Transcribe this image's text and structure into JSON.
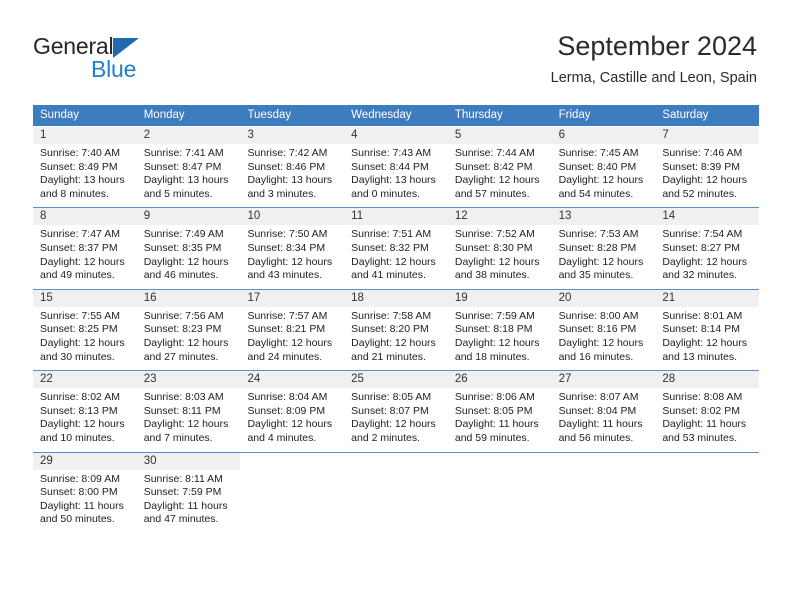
{
  "brand": {
    "name_top": "General",
    "name_bottom": "Blue",
    "triangle_color": "#1f69b0",
    "blue_color": "#1f7fd0"
  },
  "header": {
    "title": "September 2024",
    "subtitle": "Lerma, Castille and Leon, Spain"
  },
  "theme": {
    "header_row_bg": "#3d7cbf",
    "daynum_bg": "#f0f0f0",
    "week_separator": "#5a8fc8",
    "text": "#222222"
  },
  "weekdays": [
    "Sunday",
    "Monday",
    "Tuesday",
    "Wednesday",
    "Thursday",
    "Friday",
    "Saturday"
  ],
  "weeks": [
    [
      {
        "day": "1",
        "sunrise": "Sunrise: 7:40 AM",
        "sunset": "Sunset: 8:49 PM",
        "daylight1": "Daylight: 13 hours",
        "daylight2": "and 8 minutes."
      },
      {
        "day": "2",
        "sunrise": "Sunrise: 7:41 AM",
        "sunset": "Sunset: 8:47 PM",
        "daylight1": "Daylight: 13 hours",
        "daylight2": "and 5 minutes."
      },
      {
        "day": "3",
        "sunrise": "Sunrise: 7:42 AM",
        "sunset": "Sunset: 8:46 PM",
        "daylight1": "Daylight: 13 hours",
        "daylight2": "and 3 minutes."
      },
      {
        "day": "4",
        "sunrise": "Sunrise: 7:43 AM",
        "sunset": "Sunset: 8:44 PM",
        "daylight1": "Daylight: 13 hours",
        "daylight2": "and 0 minutes."
      },
      {
        "day": "5",
        "sunrise": "Sunrise: 7:44 AM",
        "sunset": "Sunset: 8:42 PM",
        "daylight1": "Daylight: 12 hours",
        "daylight2": "and 57 minutes."
      },
      {
        "day": "6",
        "sunrise": "Sunrise: 7:45 AM",
        "sunset": "Sunset: 8:40 PM",
        "daylight1": "Daylight: 12 hours",
        "daylight2": "and 54 minutes."
      },
      {
        "day": "7",
        "sunrise": "Sunrise: 7:46 AM",
        "sunset": "Sunset: 8:39 PM",
        "daylight1": "Daylight: 12 hours",
        "daylight2": "and 52 minutes."
      }
    ],
    [
      {
        "day": "8",
        "sunrise": "Sunrise: 7:47 AM",
        "sunset": "Sunset: 8:37 PM",
        "daylight1": "Daylight: 12 hours",
        "daylight2": "and 49 minutes."
      },
      {
        "day": "9",
        "sunrise": "Sunrise: 7:49 AM",
        "sunset": "Sunset: 8:35 PM",
        "daylight1": "Daylight: 12 hours",
        "daylight2": "and 46 minutes."
      },
      {
        "day": "10",
        "sunrise": "Sunrise: 7:50 AM",
        "sunset": "Sunset: 8:34 PM",
        "daylight1": "Daylight: 12 hours",
        "daylight2": "and 43 minutes."
      },
      {
        "day": "11",
        "sunrise": "Sunrise: 7:51 AM",
        "sunset": "Sunset: 8:32 PM",
        "daylight1": "Daylight: 12 hours",
        "daylight2": "and 41 minutes."
      },
      {
        "day": "12",
        "sunrise": "Sunrise: 7:52 AM",
        "sunset": "Sunset: 8:30 PM",
        "daylight1": "Daylight: 12 hours",
        "daylight2": "and 38 minutes."
      },
      {
        "day": "13",
        "sunrise": "Sunrise: 7:53 AM",
        "sunset": "Sunset: 8:28 PM",
        "daylight1": "Daylight: 12 hours",
        "daylight2": "and 35 minutes."
      },
      {
        "day": "14",
        "sunrise": "Sunrise: 7:54 AM",
        "sunset": "Sunset: 8:27 PM",
        "daylight1": "Daylight: 12 hours",
        "daylight2": "and 32 minutes."
      }
    ],
    [
      {
        "day": "15",
        "sunrise": "Sunrise: 7:55 AM",
        "sunset": "Sunset: 8:25 PM",
        "daylight1": "Daylight: 12 hours",
        "daylight2": "and 30 minutes."
      },
      {
        "day": "16",
        "sunrise": "Sunrise: 7:56 AM",
        "sunset": "Sunset: 8:23 PM",
        "daylight1": "Daylight: 12 hours",
        "daylight2": "and 27 minutes."
      },
      {
        "day": "17",
        "sunrise": "Sunrise: 7:57 AM",
        "sunset": "Sunset: 8:21 PM",
        "daylight1": "Daylight: 12 hours",
        "daylight2": "and 24 minutes."
      },
      {
        "day": "18",
        "sunrise": "Sunrise: 7:58 AM",
        "sunset": "Sunset: 8:20 PM",
        "daylight1": "Daylight: 12 hours",
        "daylight2": "and 21 minutes."
      },
      {
        "day": "19",
        "sunrise": "Sunrise: 7:59 AM",
        "sunset": "Sunset: 8:18 PM",
        "daylight1": "Daylight: 12 hours",
        "daylight2": "and 18 minutes."
      },
      {
        "day": "20",
        "sunrise": "Sunrise: 8:00 AM",
        "sunset": "Sunset: 8:16 PM",
        "daylight1": "Daylight: 12 hours",
        "daylight2": "and 16 minutes."
      },
      {
        "day": "21",
        "sunrise": "Sunrise: 8:01 AM",
        "sunset": "Sunset: 8:14 PM",
        "daylight1": "Daylight: 12 hours",
        "daylight2": "and 13 minutes."
      }
    ],
    [
      {
        "day": "22",
        "sunrise": "Sunrise: 8:02 AM",
        "sunset": "Sunset: 8:13 PM",
        "daylight1": "Daylight: 12 hours",
        "daylight2": "and 10 minutes."
      },
      {
        "day": "23",
        "sunrise": "Sunrise: 8:03 AM",
        "sunset": "Sunset: 8:11 PM",
        "daylight1": "Daylight: 12 hours",
        "daylight2": "and 7 minutes."
      },
      {
        "day": "24",
        "sunrise": "Sunrise: 8:04 AM",
        "sunset": "Sunset: 8:09 PM",
        "daylight1": "Daylight: 12 hours",
        "daylight2": "and 4 minutes."
      },
      {
        "day": "25",
        "sunrise": "Sunrise: 8:05 AM",
        "sunset": "Sunset: 8:07 PM",
        "daylight1": "Daylight: 12 hours",
        "daylight2": "and 2 minutes."
      },
      {
        "day": "26",
        "sunrise": "Sunrise: 8:06 AM",
        "sunset": "Sunset: 8:05 PM",
        "daylight1": "Daylight: 11 hours",
        "daylight2": "and 59 minutes."
      },
      {
        "day": "27",
        "sunrise": "Sunrise: 8:07 AM",
        "sunset": "Sunset: 8:04 PM",
        "daylight1": "Daylight: 11 hours",
        "daylight2": "and 56 minutes."
      },
      {
        "day": "28",
        "sunrise": "Sunrise: 8:08 AM",
        "sunset": "Sunset: 8:02 PM",
        "daylight1": "Daylight: 11 hours",
        "daylight2": "and 53 minutes."
      }
    ],
    [
      {
        "day": "29",
        "sunrise": "Sunrise: 8:09 AM",
        "sunset": "Sunset: 8:00 PM",
        "daylight1": "Daylight: 11 hours",
        "daylight2": "and 50 minutes."
      },
      {
        "day": "30",
        "sunrise": "Sunrise: 8:11 AM",
        "sunset": "Sunset: 7:59 PM",
        "daylight1": "Daylight: 11 hours",
        "daylight2": "and 47 minutes."
      },
      {
        "day": "",
        "sunrise": "",
        "sunset": "",
        "daylight1": "",
        "daylight2": ""
      },
      {
        "day": "",
        "sunrise": "",
        "sunset": "",
        "daylight1": "",
        "daylight2": ""
      },
      {
        "day": "",
        "sunrise": "",
        "sunset": "",
        "daylight1": "",
        "daylight2": ""
      },
      {
        "day": "",
        "sunrise": "",
        "sunset": "",
        "daylight1": "",
        "daylight2": ""
      },
      {
        "day": "",
        "sunrise": "",
        "sunset": "",
        "daylight1": "",
        "daylight2": ""
      }
    ]
  ]
}
